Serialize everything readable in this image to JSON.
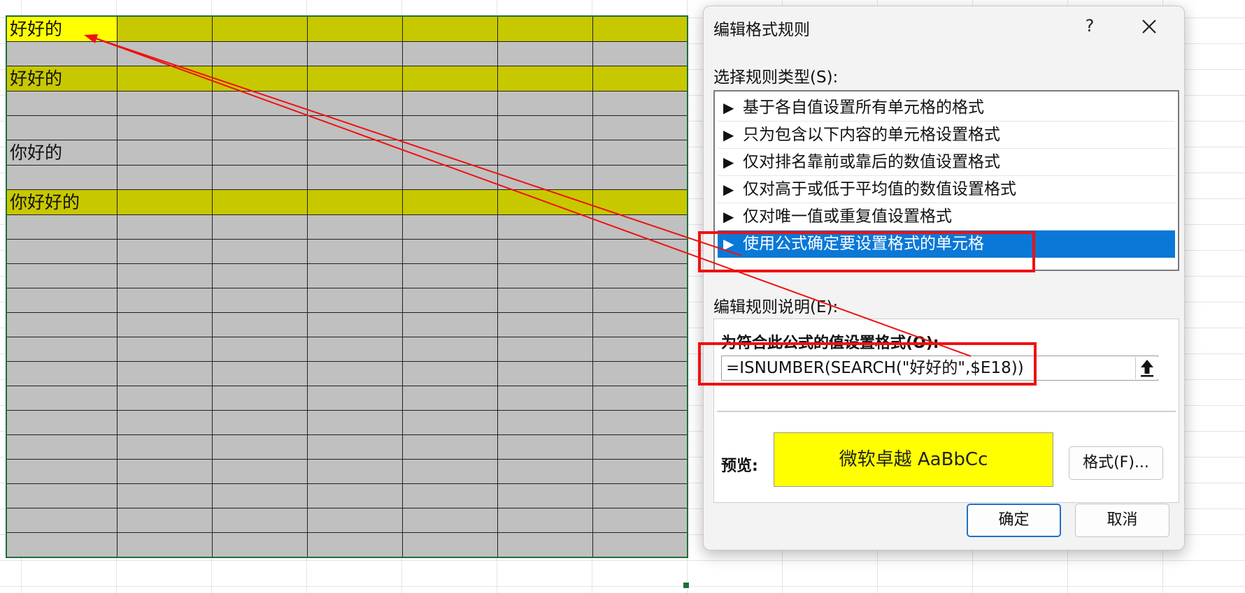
{
  "sheet": {
    "rows": [
      {
        "text": "好好的",
        "style": "first"
      },
      {
        "text": "",
        "style": "none"
      },
      {
        "text": "好好的",
        "style": "hl"
      },
      {
        "text": "",
        "style": "none"
      },
      {
        "text": "",
        "style": "none"
      },
      {
        "text": "你好的",
        "style": "none"
      },
      {
        "text": "",
        "style": "none"
      },
      {
        "text": "你好好的",
        "style": "hl"
      },
      {
        "text": "",
        "style": "none"
      },
      {
        "text": "",
        "style": "none"
      },
      {
        "text": "",
        "style": "none"
      },
      {
        "text": "",
        "style": "none"
      },
      {
        "text": "",
        "style": "none"
      },
      {
        "text": "",
        "style": "none"
      },
      {
        "text": "",
        "style": "none"
      },
      {
        "text": "",
        "style": "none"
      },
      {
        "text": "",
        "style": "none"
      },
      {
        "text": "",
        "style": "none"
      },
      {
        "text": "",
        "style": "none"
      },
      {
        "text": "",
        "style": "none"
      },
      {
        "text": "",
        "style": "none"
      },
      {
        "text": "",
        "style": "none"
      }
    ],
    "column_count": 7,
    "colors": {
      "cell": "#c0c0c0",
      "highlight": "#c8c800",
      "active_highlight": "#ffff00"
    }
  },
  "dialog": {
    "title": "编辑格式规则",
    "help_label": "?",
    "select_rule_type_label": "选择规则类型(S):",
    "rule_types": [
      "基于各自值设置所有单元格的格式",
      "只为包含以下内容的单元格设置格式",
      "仅对排名靠前或靠后的数值设置格式",
      "仅对高于或低于平均值的数值设置格式",
      "仅对唯一值或重复值设置格式",
      "使用公式确定要设置格式的单元格"
    ],
    "selected_rule_index": 5,
    "rule_bullet": "▶",
    "edit_description_label": "编辑规则说明(E):",
    "formula_heading": "为符合此公式的值设置格式(O):",
    "formula_value": "=ISNUMBER(SEARCH(\"好好的\",$E18))",
    "preview_label": "预览:",
    "preview_text": "微软卓越  AaBbCc",
    "preview_color": "#ffff00",
    "format_button": "格式(F)...",
    "ok_button": "确定",
    "cancel_button": "取消",
    "accent_color": "#0a78d7"
  },
  "annotations": {
    "color": "#ee1111"
  }
}
